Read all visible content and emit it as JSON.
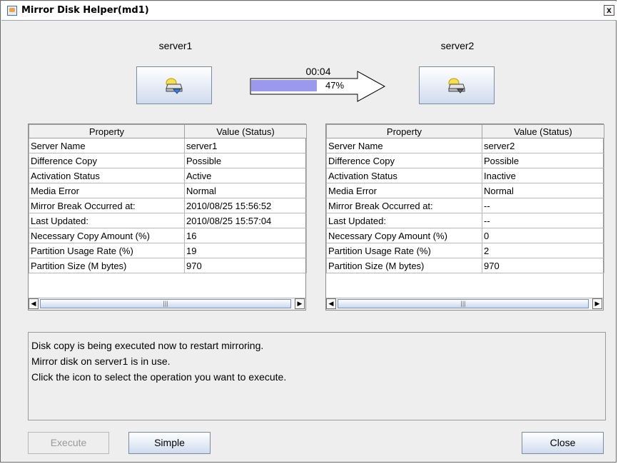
{
  "window": {
    "title": "Mirror Disk Helper(md1)",
    "close_glyph": "x"
  },
  "servers": [
    {
      "label": "server1",
      "icon": "active-disk-icon"
    },
    {
      "label": "server2",
      "icon": "disk-icon"
    }
  ],
  "copy": {
    "elapsed": "00:04",
    "progress": 0.47,
    "progress_label": "47%"
  },
  "tables": [
    {
      "headers": [
        "Property",
        "Value (Status)"
      ],
      "rows": [
        [
          "Server Name",
          "server1"
        ],
        [
          "Difference Copy",
          "Possible"
        ],
        [
          "Activation Status",
          "Active"
        ],
        [
          "Media Error",
          "Normal"
        ],
        [
          "Mirror Break Occurred at:",
          "2010/08/25 15:56:52"
        ],
        [
          "Last Updated:",
          "2010/08/25 15:57:04"
        ],
        [
          "Necessary Copy Amount (%)",
          "16"
        ],
        [
          "Partition Usage Rate (%)",
          "19"
        ],
        [
          "Partition Size (M bytes)",
          "970"
        ]
      ]
    },
    {
      "headers": [
        "Property",
        "Value (Status)"
      ],
      "rows": [
        [
          "Server Name",
          "server2"
        ],
        [
          "Difference Copy",
          "Possible"
        ],
        [
          "Activation Status",
          "Inactive"
        ],
        [
          "Media Error",
          "Normal"
        ],
        [
          "Mirror Break Occurred at:",
          "--"
        ],
        [
          "Last Updated:",
          "--"
        ],
        [
          "Necessary Copy Amount (%)",
          "0"
        ],
        [
          "Partition Usage Rate (%)",
          "2"
        ],
        [
          "Partition Size (M bytes)",
          "970"
        ]
      ]
    }
  ],
  "scrollbar": {
    "left_arrow": "◀",
    "right_arrow": "▶",
    "thumb_grip": "|||"
  },
  "message": {
    "lines": [
      "Disk copy is being executed now to restart mirroring.",
      "Mirror disk on server1 is in use.",
      "Click the icon to select the operation you want to execute."
    ]
  },
  "buttons": {
    "execute": "Execute",
    "simple": "Simple",
    "close": "Close"
  },
  "colors": {
    "progress_fill": "#9b99ee",
    "button_gradient_end": "#cfdcee",
    "disk_yellow": "#f7e04a",
    "disk_blue": "#3d7fd8"
  }
}
